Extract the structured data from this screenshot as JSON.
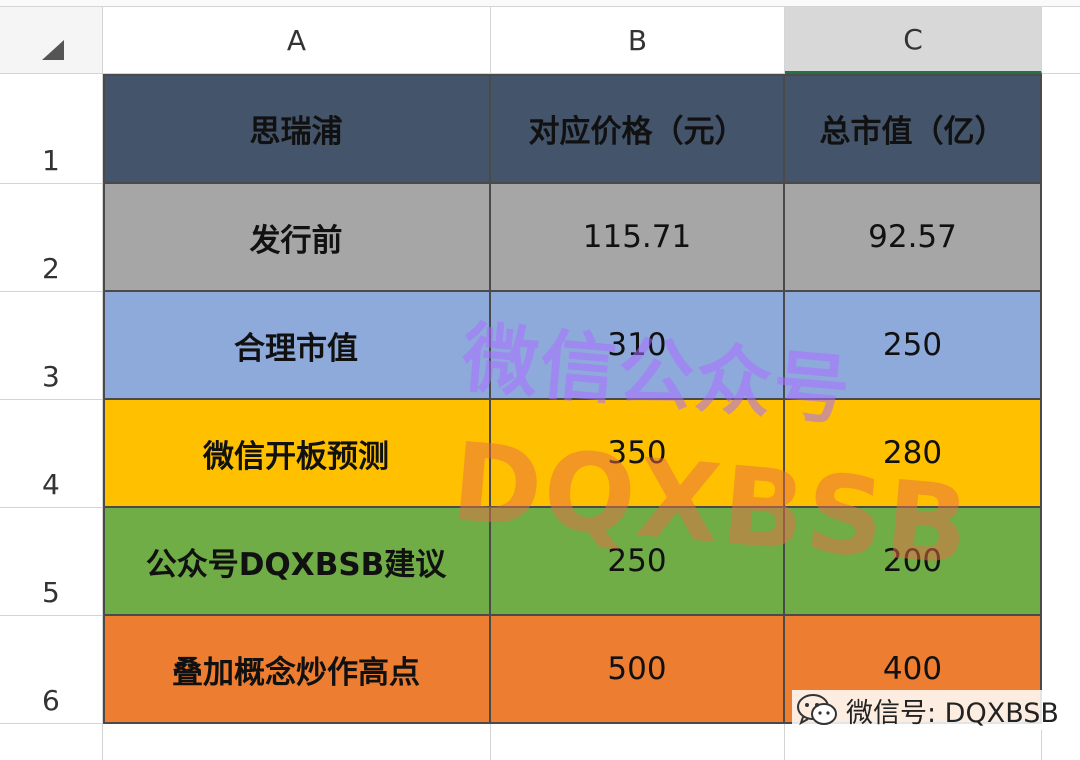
{
  "columns": [
    "A",
    "B",
    "C"
  ],
  "rows": [
    "1",
    "2",
    "3",
    "4",
    "5",
    "6"
  ],
  "table": {
    "header": [
      "思瑞浦",
      "对应价格（元）",
      "总市值（亿）"
    ],
    "body": [
      {
        "label": "发行前",
        "price": "115.71",
        "cap": "92.57",
        "color": "#a6a6a6"
      },
      {
        "label": "合理市值",
        "price": "310",
        "cap": "250",
        "color": "#8eaadb"
      },
      {
        "label": "微信开板预测",
        "price": "350",
        "cap": "280",
        "color": "#ffc000"
      },
      {
        "label": "公众号DQXBSB建议",
        "price": "250",
        "cap": "200",
        "color": "#70ad47"
      },
      {
        "label": "叠加概念炒作高点",
        "price": "500",
        "cap": "400",
        "color": "#ed7d31"
      }
    ],
    "header_color": "#44546a"
  },
  "watermark": {
    "line1": "微信公众号",
    "line2": "DQXBSB"
  },
  "wechat_badge": {
    "icon": "wechat-icon",
    "text": "微信号: DQXBSB"
  }
}
